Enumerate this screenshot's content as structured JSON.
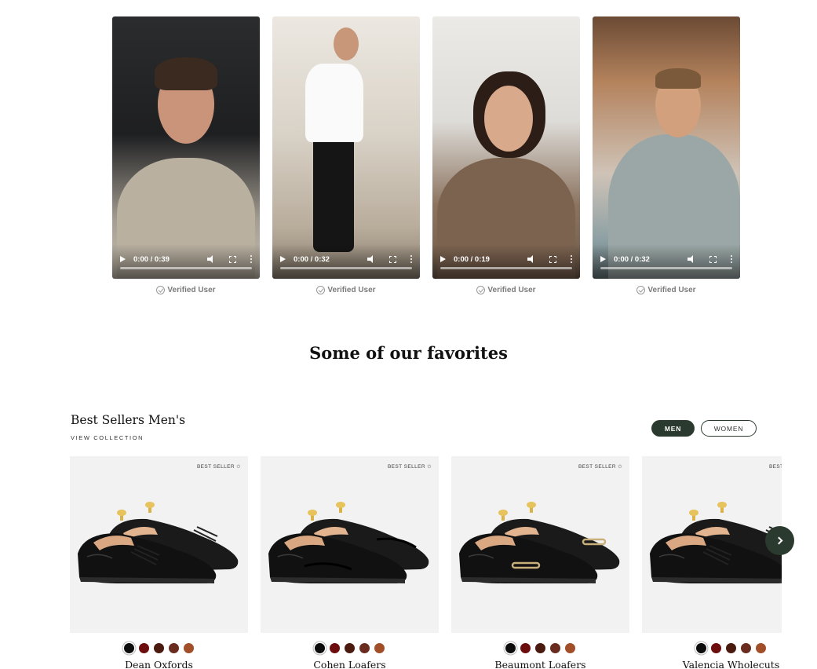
{
  "videos": [
    {
      "time": "0:00 / 0:39",
      "progress": 0.0,
      "verified_label": "Verified User"
    },
    {
      "time": "0:00 / 0:32",
      "progress": 0.0,
      "verified_label": "Verified User"
    },
    {
      "time": "0:00 / 0:19",
      "progress": 0.0,
      "verified_label": "Verified User"
    },
    {
      "time": "0:00 / 0:32",
      "progress": 0.0,
      "verified_label": "Verified User"
    }
  ],
  "favorites": {
    "title": "Some of our favorites"
  },
  "collection": {
    "title": "Best Sellers Men's",
    "view_link": "VIEW COLLECTION",
    "toggle": {
      "men": "MEN",
      "women": "WOMEN",
      "selected": "MEN"
    }
  },
  "products": [
    {
      "badge": "BEST SELLER ✩",
      "name": "Dean Oxfords",
      "swatches": [
        "#0d0d0d",
        "#6e0d0d",
        "#4a1a0e",
        "#6a2c1e",
        "#a24e28"
      ]
    },
    {
      "badge": "BEST SELLER ✩",
      "name": "Cohen Loafers",
      "swatches": [
        "#0d0d0d",
        "#6e0d0d",
        "#4a1a0e",
        "#6a2c1e",
        "#a24e28"
      ]
    },
    {
      "badge": "BEST SELLER ✩",
      "name": "Beaumont Loafers",
      "swatches": [
        "#0d0d0d",
        "#6e0d0d",
        "#4a1a0e",
        "#6a2c1e",
        "#a24e28"
      ]
    },
    {
      "badge": "BEST SELLER ✩",
      "name": "Valencia Wholecuts",
      "swatches": [
        "#0d0d0d",
        "#6e0d0d",
        "#4a1a0e",
        "#6a2c1e",
        "#a24e28"
      ]
    }
  ],
  "colors": {
    "accent": "#2a3a2e",
    "card_bg": "#f2f2f2"
  }
}
